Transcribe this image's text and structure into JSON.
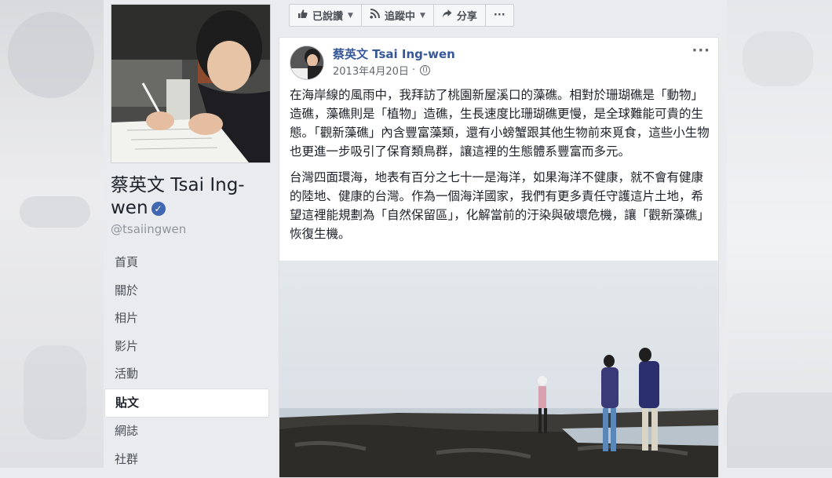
{
  "page": {
    "name": "蔡英文 Tsai Ing-wen",
    "handle": "@tsaiingwen",
    "verified_mark": "✓"
  },
  "nav": {
    "items": [
      "首頁",
      "關於",
      "相片",
      "影片",
      "活動",
      "貼文",
      "網誌",
      "社群"
    ],
    "active_index": 5
  },
  "actions": {
    "like": "已說讚",
    "follow": "追蹤中",
    "share": "分享",
    "more": "···"
  },
  "post": {
    "author": "蔡英文 Tsai Ing-wen",
    "date": "2013年4月20日",
    "separator": "·",
    "more": "···",
    "paragraphs": [
      "在海岸線的風雨中，我拜訪了桃園新屋溪口的藻礁。相對於珊瑚礁是「動物」造礁，藻礁則是「植物」造礁，生長速度比珊瑚礁更慢，是全球難能可貴的生態。「觀新藻礁」內含豐富藻類，還有小螃蟹跟其他生物前來覓食，這些小生物也更進一步吸引了保育類鳥群，讓這裡的生態體系豐富而多元。",
      "台灣四面環海，地表有百分之七十一是海洋，如果海洋不健康，就不會有健康的陸地、健康的台灣。作為一個海洋國家，我們有更多責任守護這片土地，希望這裡能規劃為「自然保留區」，化解當前的汙染與破壞危機，讓「觀新藻礁」恢復生機。"
    ]
  },
  "colors": {
    "link": "#365899",
    "background": "#e9ebee"
  }
}
